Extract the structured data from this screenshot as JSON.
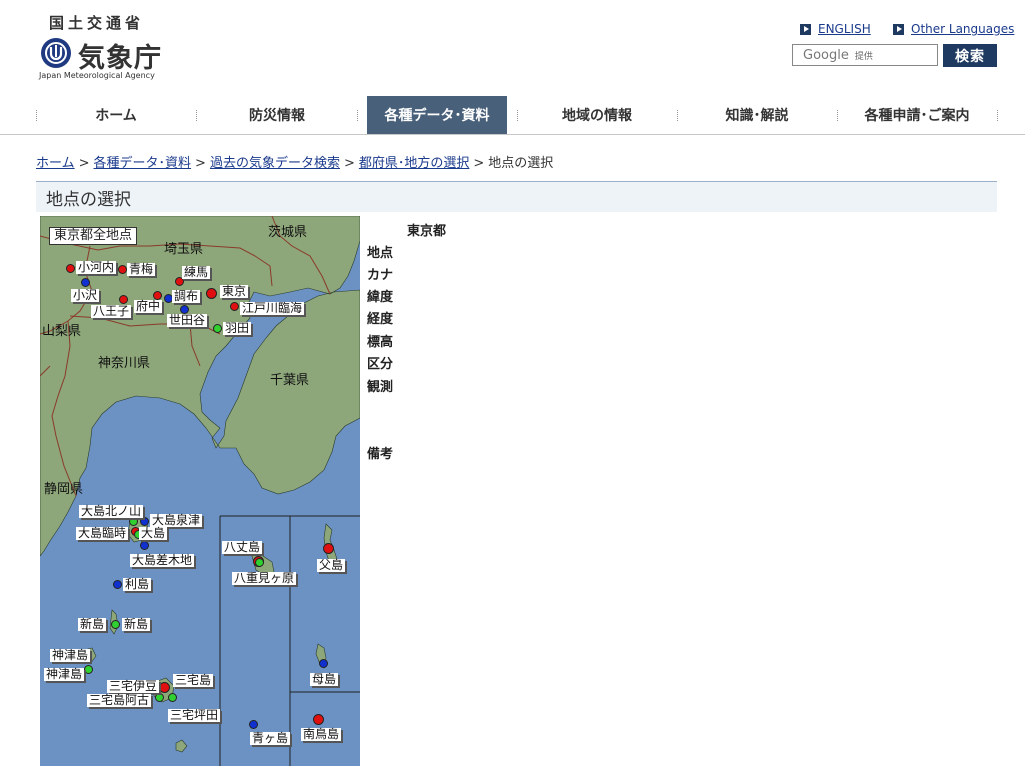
{
  "header": {
    "ministry": "国土交通省",
    "agency_name": "気象庁",
    "agency_en": "Japan Meteorological Agency",
    "links": {
      "english": "ENGLISH",
      "other_languages": "Other Languages"
    },
    "search": {
      "placeholder": "Google",
      "provider": "提供",
      "button": "検索"
    }
  },
  "nav": {
    "items": [
      "ホーム",
      "防災情報",
      "各種データ･資料",
      "地域の情報",
      "知識･解説",
      "各種申請･ご案内"
    ],
    "active_index": 2
  },
  "breadcrumb": {
    "links": [
      "ホーム",
      "各種データ･資料",
      "過去の気象データ検索",
      "都府県･地方の選択"
    ],
    "current": "地点の選択"
  },
  "title": "地点の選択",
  "map": {
    "all_points_label": "東京都全地点",
    "prefectures": [
      "茨城県",
      "埼玉県",
      "山梨県",
      "神奈川県",
      "千葉県",
      "静岡県"
    ],
    "stations": {
      "ogouchi": "小河内",
      "ome": "青梅",
      "nerima": "練馬",
      "tokyo": "東京",
      "chofu": "調布",
      "edogawa": "江戸川臨海",
      "ozawa": "小沢",
      "hachioji": "八王子",
      "fuchu": "府中",
      "setagaya": "世田谷",
      "haneda": "羽田",
      "oshima_kitanoyama": "大島北ノ山",
      "oshima_senzu": "大島泉津",
      "oshima_rinji": "大島臨時",
      "oshima": "大島",
      "oshima_sashikiji": "大島差木地",
      "toshima": "利島",
      "niijima_a": "新島",
      "niijima_b": "新島",
      "kozushima_a": "神津島",
      "kozushima_b": "神津島",
      "miyake_ide": "三宅伊豆",
      "miyakejima": "三宅島",
      "miyake_ako": "三宅島阿古",
      "miyake_tsubota": "三宅坪田",
      "hachijojima": "八丈島",
      "hachijo_mikabara": "八重見ヶ原",
      "aogashima": "青ヶ島",
      "chichijima": "父島",
      "hahajima": "母島",
      "minamitorishima": "南鳥島"
    },
    "colors": {
      "sea": "#6c92c4",
      "land": "#8da67a",
      "boundary": "#8a3a2a"
    }
  },
  "info": {
    "prefecture": "東京都",
    "fields": [
      "地点",
      "カナ",
      "緯度",
      "経度",
      "標高",
      "区分",
      "観測",
      "備考"
    ]
  }
}
